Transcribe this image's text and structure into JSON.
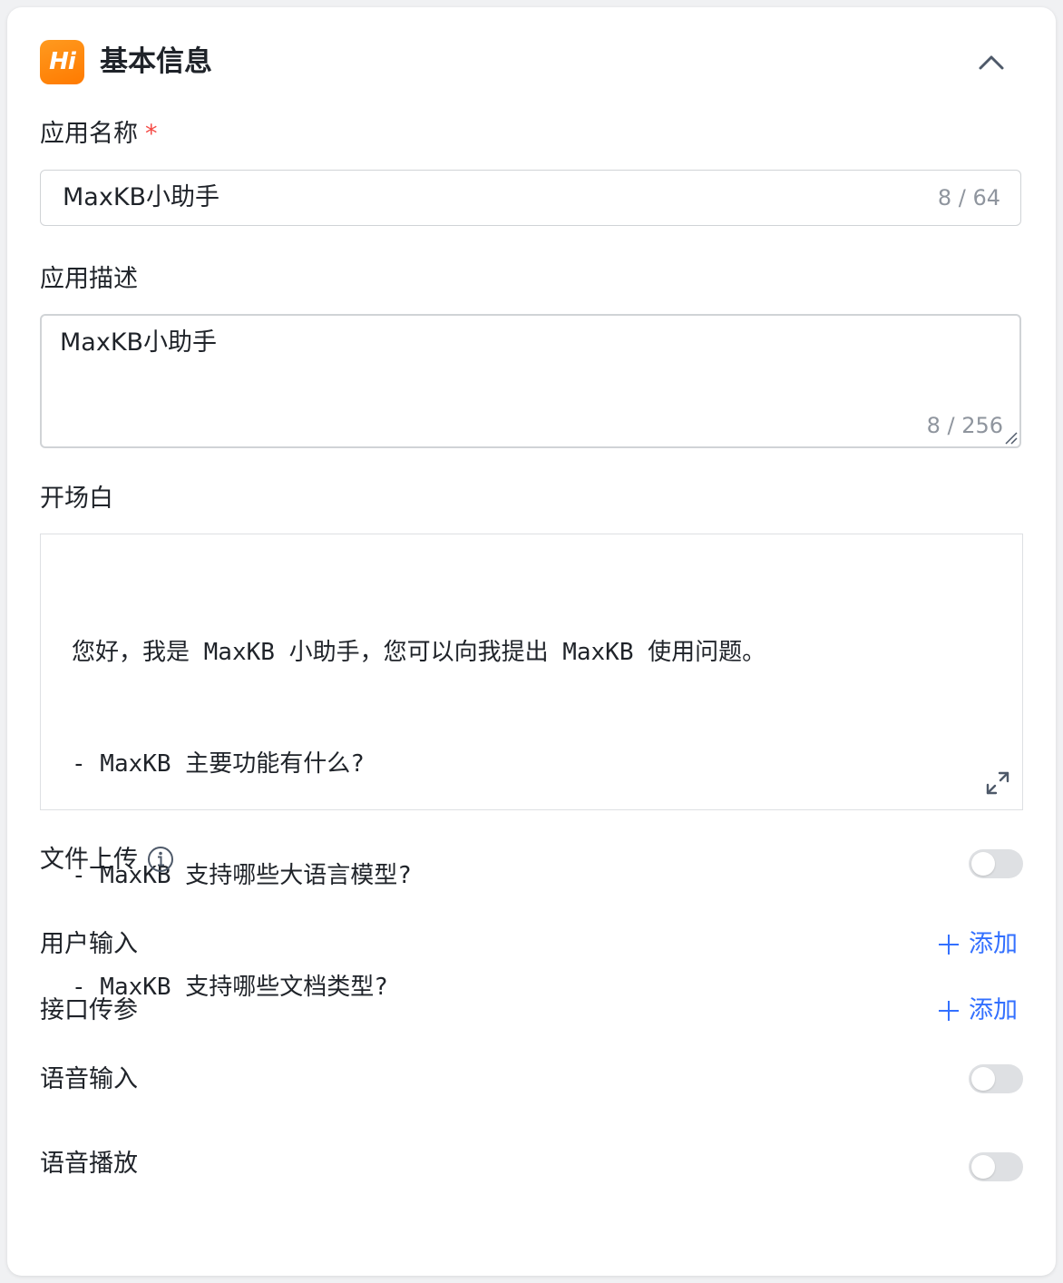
{
  "section": {
    "logo_text": "Hi",
    "title": "基本信息"
  },
  "app_name": {
    "label": "应用名称",
    "required_mark": "*",
    "value": "MaxKB小助手",
    "counter": "8 / 64"
  },
  "app_description": {
    "label": "应用描述",
    "value": "MaxKB小助手",
    "counter": "8 / 256"
  },
  "prologue": {
    "label": "开场白",
    "lines": [
      "您好，我是 MaxKB 小助手，您可以向我提出 MaxKB 使用问题。",
      "- MaxKB 主要功能有什么?",
      "- MaxKB 支持哪些大语言模型?",
      "- MaxKB 支持哪些文档类型?"
    ]
  },
  "file_upload": {
    "label": "文件上传",
    "enabled": false
  },
  "user_input": {
    "label": "用户输入",
    "add_label": "添加"
  },
  "api_params": {
    "label": "接口传参",
    "add_label": "添加"
  },
  "voice_input": {
    "label": "语音输入",
    "enabled": false
  },
  "voice_playback": {
    "label": "语音播放",
    "enabled": false
  },
  "colors": {
    "accent": "#3370ff",
    "logo": "#ff8a00",
    "required": "#f54a45",
    "switch_off": "#dee0e3"
  }
}
